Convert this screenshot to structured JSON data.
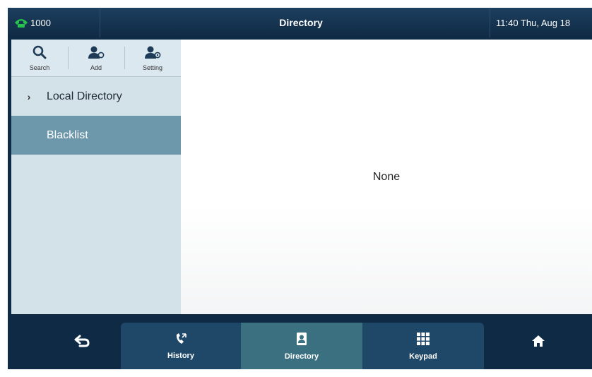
{
  "status_bar": {
    "line_number": "1000",
    "title": "Directory",
    "clock": "11:40 Thu, Aug 18",
    "line_icon_color": "#27c24c"
  },
  "toolbar": {
    "search_label": "Search",
    "add_label": "Add",
    "setting_label": "Setting"
  },
  "menu": {
    "items": [
      {
        "label": "Local Directory",
        "icon": "chevron-right-icon"
      },
      {
        "label": "Blacklist",
        "selected": true
      }
    ]
  },
  "content": {
    "empty_text": "None"
  },
  "bottom_nav": {
    "back_icon": "back-arrow-icon",
    "items": [
      {
        "label": "History",
        "icon": "history-icon"
      },
      {
        "label": "Directory",
        "icon": "directory-icon",
        "active": true
      },
      {
        "label": "Keypad",
        "icon": "keypad-icon"
      }
    ],
    "home_icon": "home-icon"
  },
  "colors": {
    "topbar": "#0f2a44",
    "left_panel": "#d3e1e9",
    "selected_item": "#6d98ac",
    "active_tab": "#3b7080",
    "tab": "#1f4868"
  }
}
